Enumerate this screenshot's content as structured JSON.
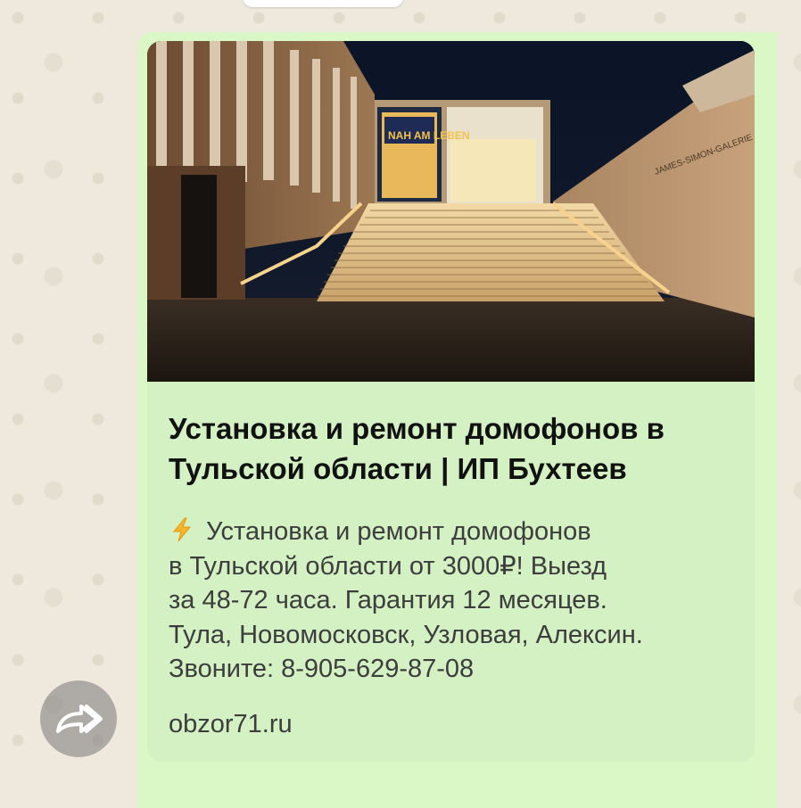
{
  "link_preview": {
    "title_line1": "Установка и ремонт домофонов в",
    "title_line2": "Тульской области | ИП Бухтеев",
    "description_emoji": "lightning-bolt-icon",
    "description": "Установка и ремонт домофонов\nв Тульской области от 3000₽! Выезд\nза 48-72 часа. Гарантия 12 месяцев.\nТула, Новомосковск, Узловая, Алексин.\nЗвоните: 8-905-629-87-08",
    "domain": "obzor71.ru",
    "image_alt_icon": "building-stairs-photo",
    "image_poster_text": [
      "NAH",
      "AM",
      "LEBEN"
    ],
    "image_wall_text": "JAMES-SIMON-GALERIE"
  },
  "forward": {
    "icon": "share-forward-icon"
  },
  "colors": {
    "bubble": "#d9f8c6",
    "card": "#d3f1c2",
    "title": "#111111",
    "text": "#3d3d3d",
    "chat_background": "#efe9dd"
  }
}
